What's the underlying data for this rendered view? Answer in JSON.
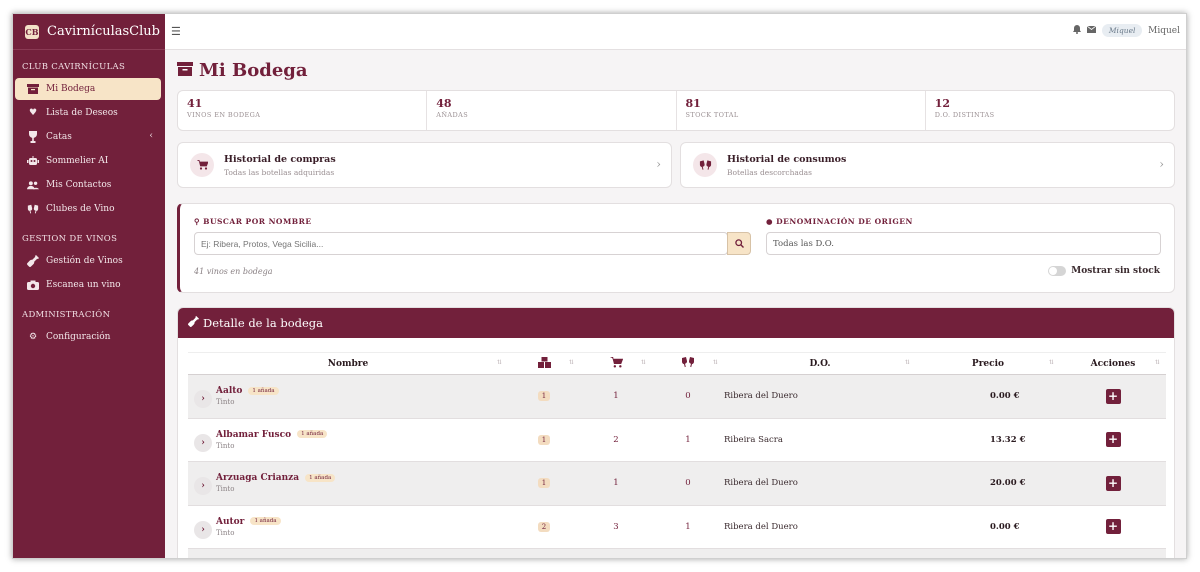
{
  "app": {
    "title": "CavirnículasClub",
    "logo_text": "CB"
  },
  "sidebar": {
    "sections": [
      {
        "label": "CLUB CAVIRNÍCULAS"
      },
      {
        "label": "GESTION DE VINOS"
      },
      {
        "label": "ADMINISTRACIÓN"
      }
    ],
    "items": [
      {
        "label": "Mi Bodega",
        "icon": "archive-icon"
      },
      {
        "label": "Lista de Deseos",
        "icon": "heart-icon"
      },
      {
        "label": "Catas",
        "icon": "wine-glass-icon"
      },
      {
        "label": "Sommelier AI",
        "icon": "robot-icon"
      },
      {
        "label": "Mis Contactos",
        "icon": "users-icon"
      },
      {
        "label": "Clubes de Vino",
        "icon": "glasses-cheers-icon"
      },
      {
        "label": "Gestión de Vinos",
        "icon": "wine-bottle-icon"
      },
      {
        "label": "Escanea un vino",
        "icon": "camera-icon"
      },
      {
        "label": "Configuración",
        "icon": "gear-icon"
      }
    ]
  },
  "topbar": {
    "user_name": "Miquel",
    "avatar_text": "Miquel"
  },
  "page": {
    "title": "Mi Bodega"
  },
  "stats": [
    {
      "value": "41",
      "label": "VINOS EN BODEGA"
    },
    {
      "value": "48",
      "label": "AÑADAS"
    },
    {
      "value": "81",
      "label": "STOCK TOTAL"
    },
    {
      "value": "12",
      "label": "D.O. DISTINTAS"
    }
  ],
  "history": [
    {
      "title": "Historial de compras",
      "subtitle": "Todas las botellas adquiridas"
    },
    {
      "title": "Historial de consumos",
      "subtitle": "Botellas descorchadas"
    }
  ],
  "search": {
    "name_label": "BUSCAR POR NOMBRE",
    "name_placeholder": "Ej: Ribera, Protos, Vega Sicilia...",
    "do_label": "DENOMINACIÓN DE ORIGEN",
    "do_value": "Todas las D.O.",
    "count_text": "41 vinos en bodega",
    "toggle_label": "Mostrar sin stock"
  },
  "detail": {
    "title": "Detalle de la bodega",
    "columns": {
      "name": "Nombre",
      "do": "D.O.",
      "price": "Precio",
      "actions": "Acciones"
    },
    "rows": [
      {
        "name": "Aalto",
        "badge": "1 añada",
        "type": "Tinto",
        "vintages": "1",
        "purchased": "1",
        "consumed": "0",
        "do": "Ribera del Duero",
        "price": "0.00 €"
      },
      {
        "name": "Albamar Fusco",
        "badge": "1 añada",
        "type": "Tinto",
        "vintages": "1",
        "purchased": "2",
        "consumed": "1",
        "do": "Ribeira Sacra",
        "price": "13.32 €"
      },
      {
        "name": "Arzuaga Crianza",
        "badge": "1 añada",
        "type": "Tinto",
        "vintages": "1",
        "purchased": "1",
        "consumed": "0",
        "do": "Ribera del Duero",
        "price": "20.00 €"
      },
      {
        "name": "Autor",
        "badge": "1 añada",
        "type": "Tinto",
        "vintages": "2",
        "purchased": "3",
        "consumed": "1",
        "do": "Ribera del Duero",
        "price": "0.00 €"
      }
    ]
  },
  "colors": {
    "primary": "#72203b",
    "accent": "#f7e4c7"
  }
}
